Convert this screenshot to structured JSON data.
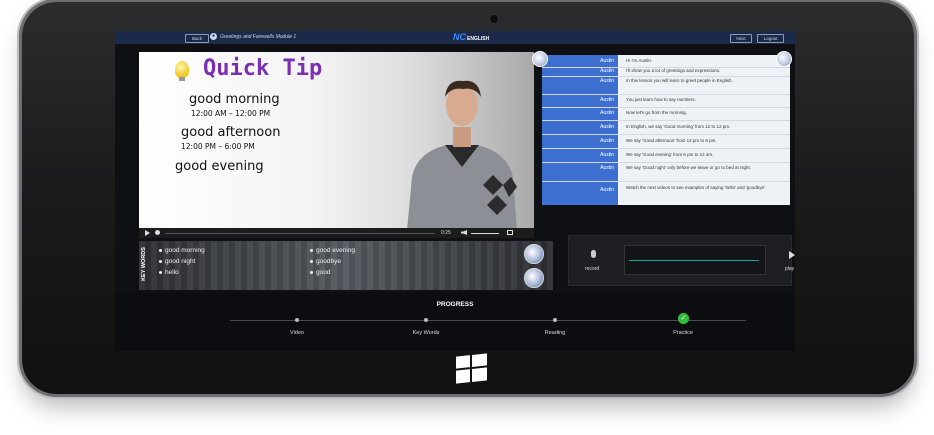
{
  "app": {
    "back_label": "Back",
    "breadcrumb": "Greetings and Farewells Module 1",
    "logo_nc": "NC",
    "logo_english": "ENGLISH",
    "next_label": "Next",
    "logout_label": "Logout"
  },
  "video": {
    "tip_title": "Quick Tip",
    "phrases": [
      {
        "phrase": "good morning",
        "time": "12:00 AM – 12:00 PM"
      },
      {
        "phrase": "good afternoon",
        "time": "12:00 PM – 6:00 PM"
      },
      {
        "phrase": "good evening",
        "time": ""
      }
    ],
    "time_display": "0:25"
  },
  "chat": {
    "messages": [
      {
        "speaker": "Austin",
        "text": "Hi I'm Austin."
      },
      {
        "speaker": "Austin",
        "text": "I'll show you a lot of greetings and expressions."
      },
      {
        "speaker": "Austin",
        "text": "In this lesson you will learn to greet people in English."
      },
      {
        "speaker": "Austin",
        "text": "You just learn how to say numbers."
      },
      {
        "speaker": "Austin",
        "text": "Now let's go from the morning."
      },
      {
        "speaker": "Austin",
        "text": "In English, we say 'Good morning' from 12 to 12 pm."
      },
      {
        "speaker": "Austin",
        "text": "We say 'Good afternoon' from 12 pm to 6 pm."
      },
      {
        "speaker": "Austin",
        "text": "We say 'Good evening' from 6 pm to 12 am."
      },
      {
        "speaker": "Austin",
        "text": "We say 'Good night' only before we leave or go to bed at night."
      },
      {
        "speaker": "Austin",
        "text": "Watch the next videos to see examples of saying 'hello' and 'goodbye'."
      }
    ]
  },
  "keywords": {
    "label": "KEY WORDS",
    "col1": [
      "good morning",
      "good night",
      "hello"
    ],
    "col2": [
      "good evening",
      "goodbye",
      "good"
    ]
  },
  "recorder": {
    "record_label": "record",
    "play_label": "play"
  },
  "progress": {
    "title": "PROGRESS",
    "stages": [
      "Video",
      "Key Words",
      "Reading",
      "Practice"
    ],
    "completed_stage": "Practice"
  },
  "colors": {
    "accent": "#3d6fd0",
    "topbar": "#1b2a48",
    "tip_title": "#7a2fb5",
    "done": "#2fc13c"
  }
}
